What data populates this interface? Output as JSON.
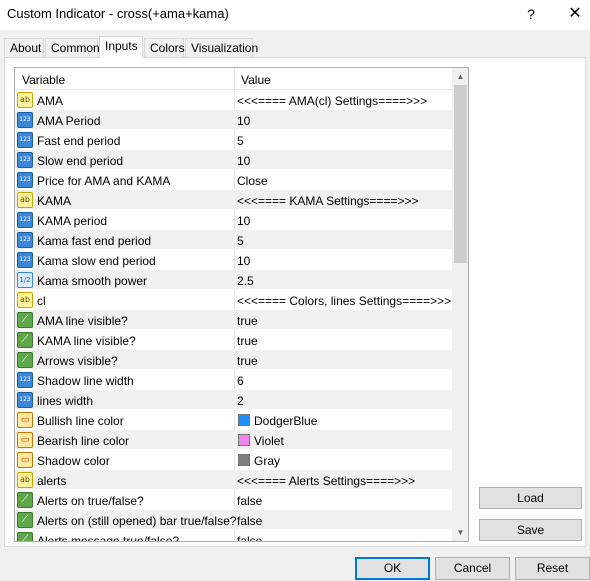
{
  "window": {
    "title": "Custom Indicator - cross(+ama+kama)",
    "help": "?",
    "close": "✕"
  },
  "tabs": [
    "About",
    "Common",
    "Inputs",
    "Colors",
    "Visualization"
  ],
  "active_tab": "Inputs",
  "grid": {
    "col_variable": "Variable",
    "col_value": "Value",
    "rows": [
      {
        "icon": "ab",
        "name": "AMA",
        "value": "<<<====  AMA(cl) Settings====>>>"
      },
      {
        "icon": "123",
        "name": "AMA Period",
        "value": "10"
      },
      {
        "icon": "123",
        "name": "Fast end period",
        "value": "5"
      },
      {
        "icon": "123",
        "name": "Slow end period",
        "value": "10"
      },
      {
        "icon": "123",
        "name": "Price for AMA and KAMA",
        "value": "Close"
      },
      {
        "icon": "ab",
        "name": "KAMA",
        "value": "<<<====  KAMA Settings====>>>"
      },
      {
        "icon": "123",
        "name": "KAMA period",
        "value": "10"
      },
      {
        "icon": "123",
        "name": "Kama fast end period",
        "value": "5"
      },
      {
        "icon": "123",
        "name": "Kama slow end period",
        "value": "10"
      },
      {
        "icon": "1/2",
        "name": "Kama smooth power",
        "value": "2.5"
      },
      {
        "icon": "ab",
        "name": "cl",
        "value": "<<<==== Colors, lines Settings====>>>"
      },
      {
        "icon": "bool",
        "name": "AMA line visible?",
        "value": "true"
      },
      {
        "icon": "bool",
        "name": "KAMA line visible?",
        "value": "true"
      },
      {
        "icon": "bool",
        "name": "Arrows visible?",
        "value": "true"
      },
      {
        "icon": "123",
        "name": "Shadow  line width",
        "value": "6"
      },
      {
        "icon": "123",
        "name": "lines   width",
        "value": "2"
      },
      {
        "icon": "color",
        "name": "Bullish  line  color",
        "value": "DodgerBlue",
        "swatch": "#1e90ff"
      },
      {
        "icon": "color",
        "name": "Bearish  line  color",
        "value": "Violet",
        "swatch": "#ee82ee"
      },
      {
        "icon": "color",
        "name": "Shadow  color",
        "value": "Gray",
        "swatch": "#808080"
      },
      {
        "icon": "ab",
        "name": "alerts",
        "value": "<<<==== Alerts Settings====>>>"
      },
      {
        "icon": "bool",
        "name": "Alerts on true/false?",
        "value": "false"
      },
      {
        "icon": "bool",
        "name": "Alerts on (still opened) bar true/false?",
        "value": "false"
      },
      {
        "icon": "bool",
        "name": "Alerts message true/false?",
        "value": "false"
      }
    ]
  },
  "buttons": {
    "load": "Load",
    "save": "Save",
    "ok": "OK",
    "cancel": "Cancel",
    "reset": "Reset"
  },
  "colors": {
    "accent": "#0078d7",
    "row_alt": "#f0f0f0"
  }
}
